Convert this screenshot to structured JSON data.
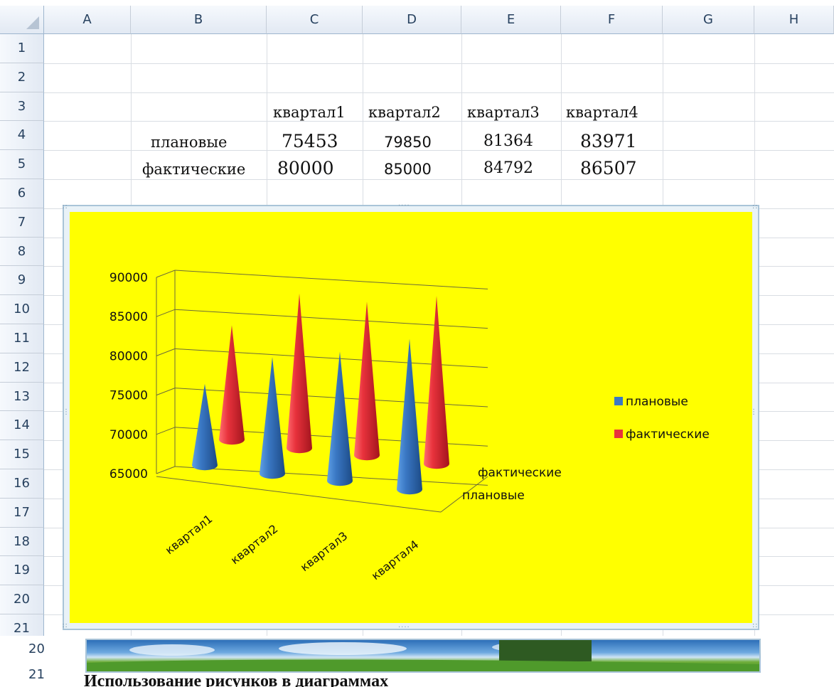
{
  "columns": [
    "A",
    "B",
    "C",
    "D",
    "E",
    "F",
    "G",
    "H"
  ],
  "rows": [
    "1",
    "2",
    "3",
    "4",
    "5",
    "6",
    "7",
    "8",
    "9",
    "10",
    "11",
    "12",
    "13",
    "14",
    "15",
    "16",
    "17",
    "18",
    "19",
    "20",
    "21"
  ],
  "table": {
    "headers": [
      "квартал1",
      "квартал2",
      "квартал3",
      "квартал4"
    ],
    "rows": [
      {
        "label": "плановые",
        "values": [
          "75453",
          "79850",
          "81364",
          "83971"
        ]
      },
      {
        "label": "фактические",
        "values": [
          "80000",
          "85000",
          "84792",
          "86507"
        ]
      }
    ]
  },
  "chart_data": {
    "type": "bar",
    "style": "3d-cone",
    "background": "#ffff00",
    "categories": [
      "квартал1",
      "квартал2",
      "квартал3",
      "квартал4"
    ],
    "depth_labels": [
      "фактические",
      "плановые"
    ],
    "series": [
      {
        "name": "плановые",
        "color": "#3a78c4",
        "values": [
          75453,
          79850,
          81364,
          83971
        ]
      },
      {
        "name": "фактические",
        "color": "#e8323c",
        "values": [
          80000,
          85000,
          84792,
          86507
        ]
      }
    ],
    "y_ticks": [
      "65000",
      "70000",
      "75000",
      "80000",
      "85000",
      "90000"
    ],
    "ylim": [
      65000,
      90000
    ],
    "grid": true,
    "legend": "right"
  },
  "bottom": {
    "row20": "20",
    "row21": "21",
    "caption": "Использование рисунков в диаграммах"
  }
}
